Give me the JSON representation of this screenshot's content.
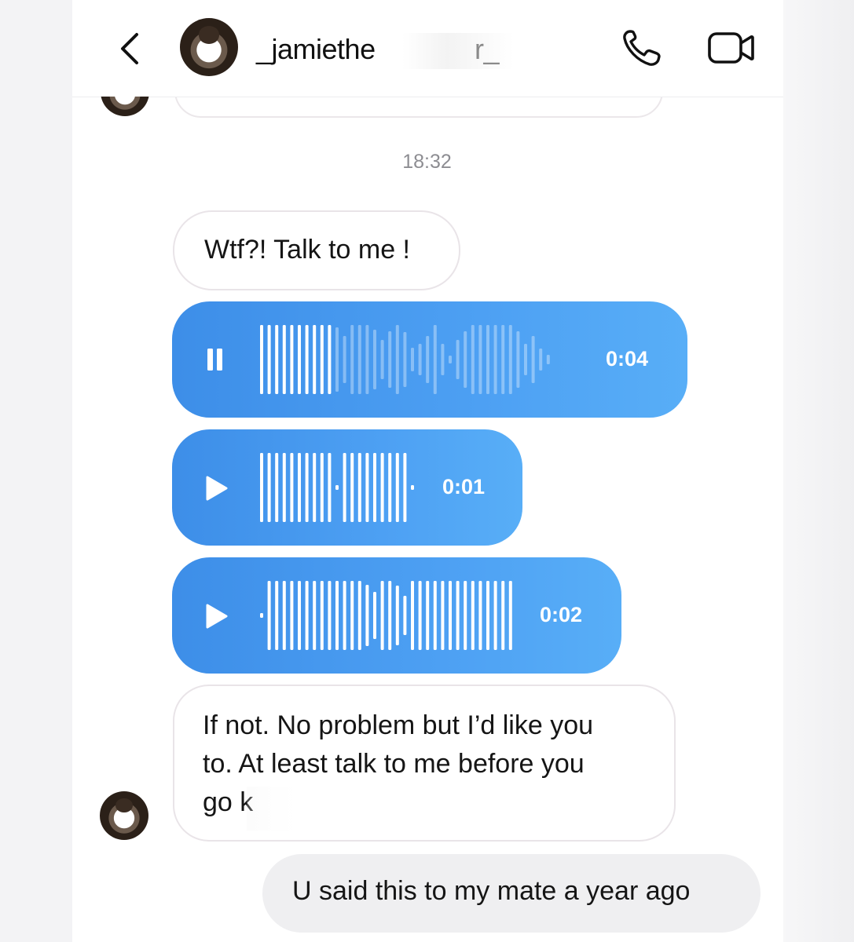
{
  "header": {
    "username_visible": "_jamiethe",
    "username_tail": "r_",
    "back_icon": "chevron-left-icon",
    "call_icon": "phone-icon",
    "video_icon": "video-camera-icon"
  },
  "timestamp": "18:32",
  "messages": [
    {
      "type": "text",
      "direction": "received",
      "text": "Wtf?! Talk to me !"
    },
    {
      "type": "voice",
      "direction": "received",
      "state": "playing",
      "duration": "0:04",
      "played_fraction": 0.25
    },
    {
      "type": "voice",
      "direction": "received",
      "state": "paused",
      "duration": "0:01"
    },
    {
      "type": "voice",
      "direction": "received",
      "state": "paused",
      "duration": "0:02"
    },
    {
      "type": "text",
      "direction": "received",
      "text": "If not. No problem but I’d like you\nto. At least talk to me before you\ngo k"
    },
    {
      "type": "text",
      "direction": "sent",
      "text": "U said this to my mate a year ago"
    }
  ],
  "colors": {
    "voice_bubble": "#4a9cf1",
    "sent_bubble": "#efeff1",
    "timestamp": "#8d8d92"
  }
}
